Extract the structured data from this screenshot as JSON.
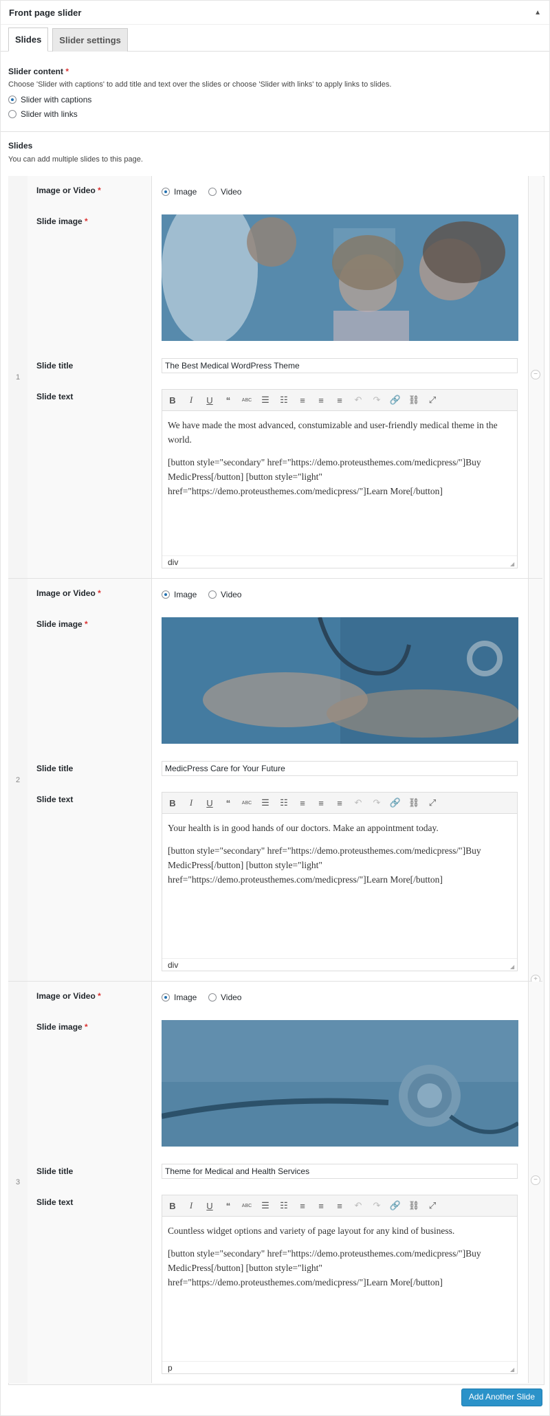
{
  "panel": {
    "title": "Front page slider",
    "collapse_icon": "triangle-up-icon"
  },
  "tabs": [
    {
      "label": "Slides",
      "active": true
    },
    {
      "label": "Slider settings",
      "active": false
    }
  ],
  "slider_content": {
    "label": "Slider content",
    "required_mark": "*",
    "description": "Choose 'Slider with captions' to add title and text over the slides or choose 'Slider with links' to apply links to slides.",
    "options": [
      {
        "label": "Slider with captions",
        "checked": true
      },
      {
        "label": "Slider with links",
        "checked": false
      }
    ]
  },
  "slides_section": {
    "label": "Slides",
    "description": "You can add multiple slides to this page."
  },
  "field_labels": {
    "image_or_video": "Image or Video",
    "slide_image": "Slide image",
    "slide_title": "Slide title",
    "slide_text": "Slide text",
    "required_mark": "*"
  },
  "media_options": {
    "image": "Image",
    "video": "Video"
  },
  "slides": [
    {
      "number": "1",
      "media": "Image",
      "image_alt": "doctor-child-mother-photo",
      "title": "The Best Medical WordPress Theme",
      "text_p1": "We have made the most advanced, constumizable and user-friendly medical theme in the world.",
      "text_p2": "[button style=\"secondary\" href=\"https://demo.proteusthemes.com/medicpress/\"]Buy MedicPress[/button] [button style=\"light\" href=\"https://demo.proteusthemes.com/medicpress/\"]Learn More[/button]",
      "status_tag": "div"
    },
    {
      "number": "2",
      "media": "Image",
      "image_alt": "doctor-stethoscope-photo",
      "title": "MedicPress Care for Your Future",
      "text_p1": "Your health is in good hands of our doctors. Make an appointment today.",
      "text_p2": "[button style=\"secondary\" href=\"https://demo.proteusthemes.com/medicpress/\"]Buy MedicPress[/button] [button style=\"light\" href=\"https://demo.proteusthemes.com/medicpress/\"]Learn More[/button]",
      "status_tag": "div"
    },
    {
      "number": "3",
      "media": "Image",
      "image_alt": "stethoscope-photo",
      "title": "Theme for Medical and Health Services",
      "text_p1": "Countless widget options and variety of page layout for any kind of business.",
      "text_p2": "[button style=\"secondary\" href=\"https://demo.proteusthemes.com/medicpress/\"]Buy MedicPress[/button] [button style=\"light\" href=\"https://demo.proteusthemes.com/medicpress/\"]Learn More[/button]",
      "status_tag": "p"
    }
  ],
  "toolbar_icons": [
    "bold-icon",
    "italic-icon",
    "underline-icon",
    "blockquote-icon",
    "strikethrough-icon",
    "bullet-list-icon",
    "numbered-list-icon",
    "align-left-icon",
    "align-center-icon",
    "align-right-icon",
    "undo-icon",
    "redo-icon",
    "link-icon",
    "unlink-icon",
    "fullscreen-icon"
  ],
  "add_button": {
    "label": "Add Another Slide"
  },
  "colors": {
    "accent": "#2b92c9",
    "required": "#dc3232",
    "image_tint": "#4a7fa0"
  }
}
